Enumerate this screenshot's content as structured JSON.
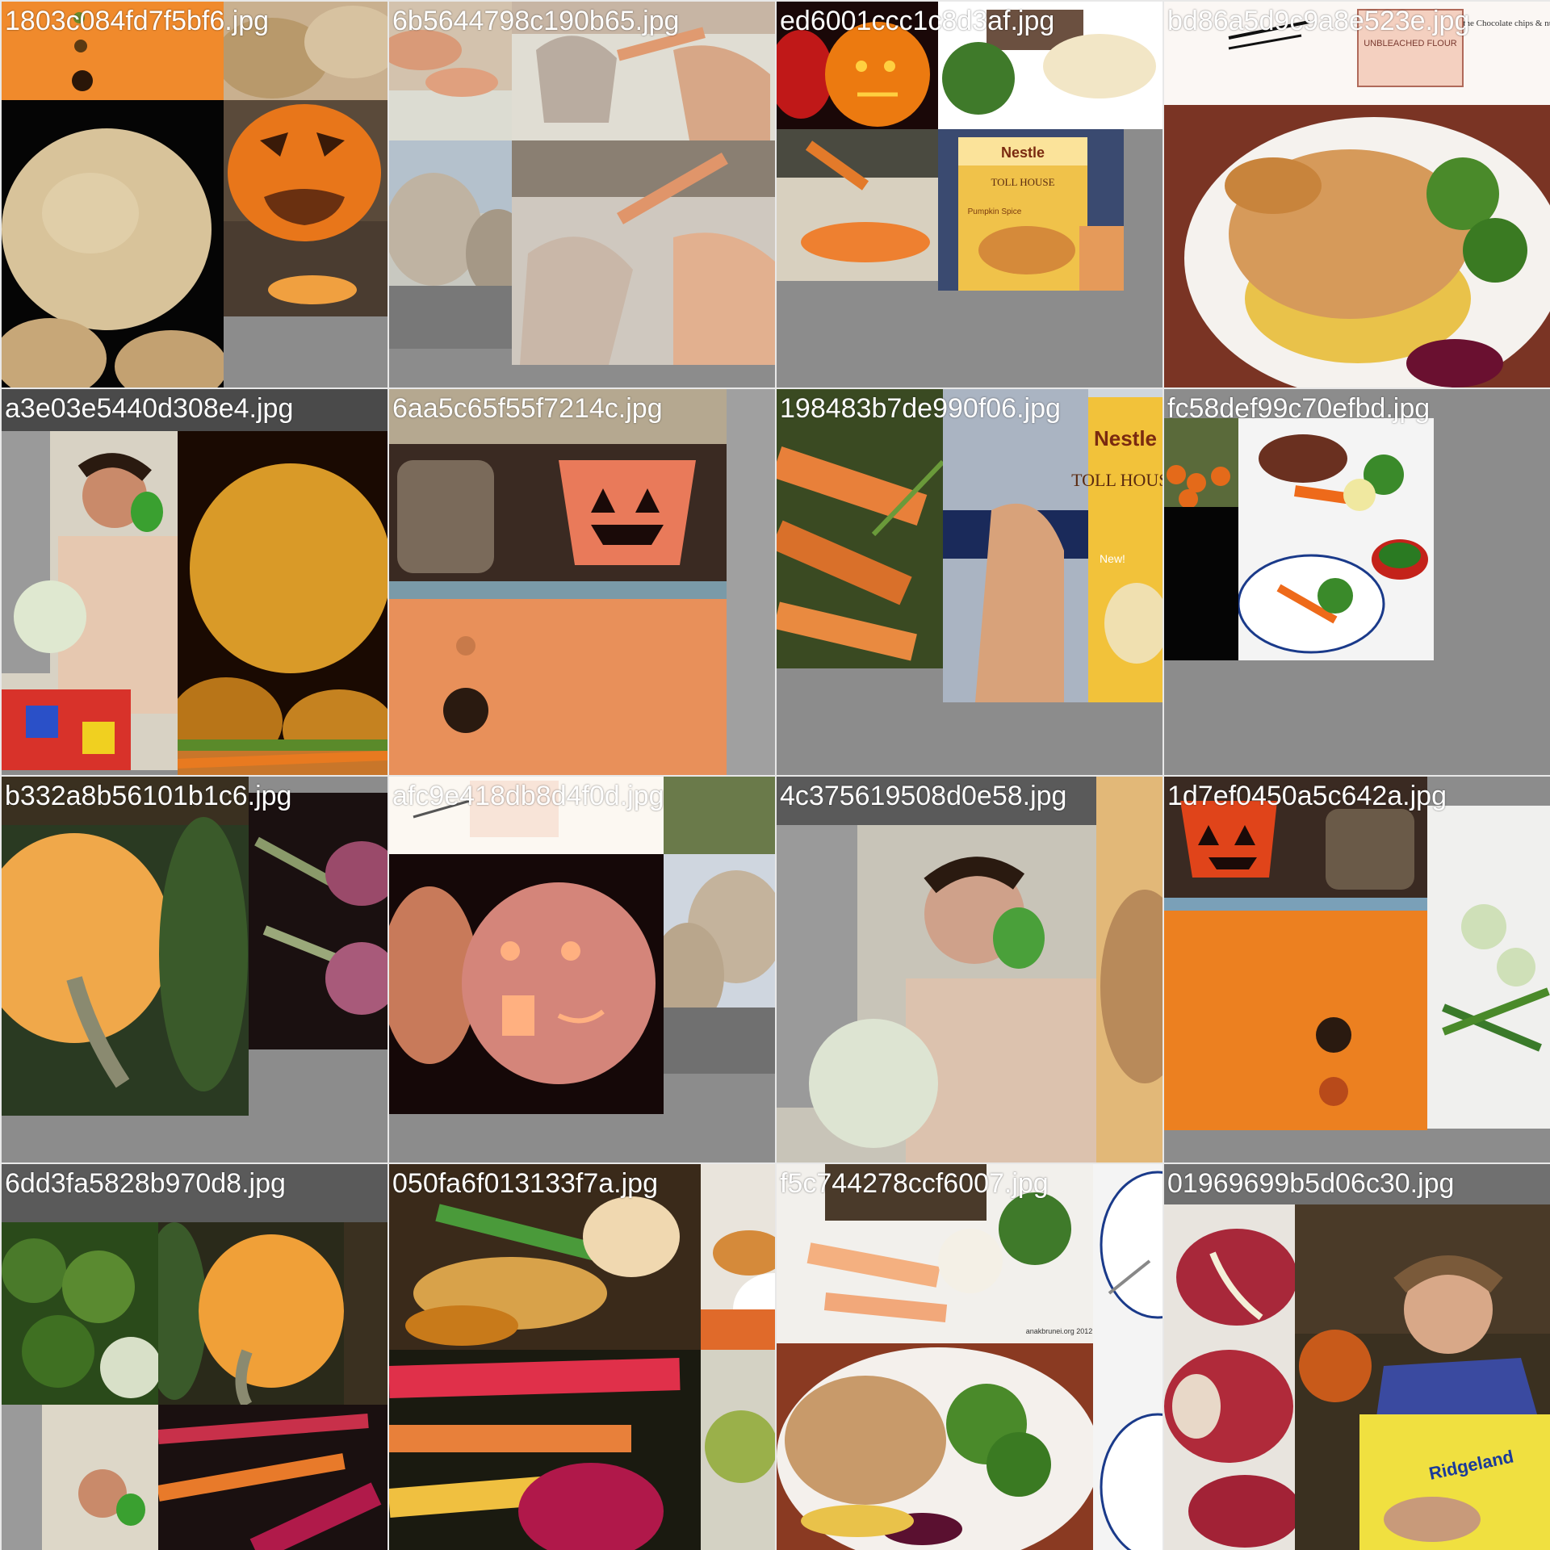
{
  "gallery": {
    "tiles": [
      {
        "filename": "1803c084fd7f5bf6.jpg"
      },
      {
        "filename": "6b5644798c190b65.jpg"
      },
      {
        "filename": "ed6001ccc1c8d3af.jpg"
      },
      {
        "filename": "bd86a5d9c9a8e523e.jpg"
      },
      {
        "filename": "a3e03e5440d308e4.jpg"
      },
      {
        "filename": "6aa5c65f55f7214c.jpg"
      },
      {
        "filename": "198483b7de990f06.jpg"
      },
      {
        "filename": "fc58def99c70efbd.jpg"
      },
      {
        "filename": "b332a8b56101b1c6.jpg"
      },
      {
        "filename": "afc9e418db8d4f0d.jpg"
      },
      {
        "filename": "4c375619508d0e58.jpg"
      },
      {
        "filename": "1d7ef0450a5c642a.jpg"
      },
      {
        "filename": "6dd3fa5828b970d8.jpg"
      },
      {
        "filename": "050fa6f013133f7a.jpg"
      },
      {
        "filename": "f5c744278ccf6007.jpg"
      },
      {
        "filename": "01969699b5d06c30.jpg"
      }
    ]
  },
  "product_text": {
    "brand": "Nestle",
    "product": "TOLL HOUSE",
    "badge": "New!",
    "flavor": "Pumpkin Spice",
    "flour_bag": "UNBLEACHED FLOUR",
    "sketch_note": "the Chocolate chips & nuts",
    "shirt_text": "Ridgeland",
    "watermark": "anakbrunei.org 2012"
  },
  "colors": {
    "background": "#8c8c8c",
    "caption": "#ffffff",
    "pumpkin_orange": "#e07a1a",
    "broccoli_green": "#3f7a2a"
  }
}
